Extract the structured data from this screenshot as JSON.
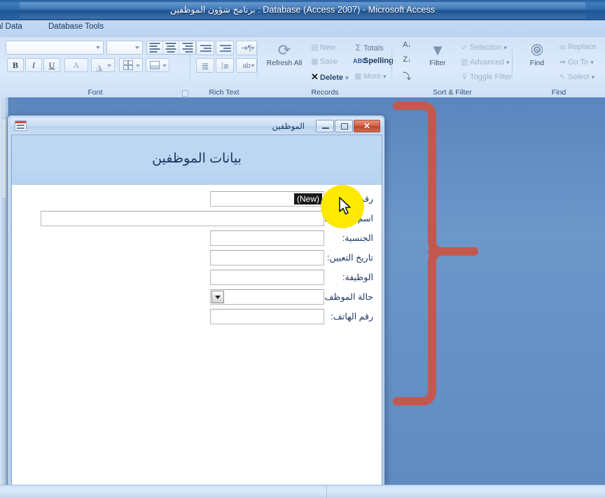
{
  "window": {
    "title": "برنامج شؤون الموظفين : Database (Access 2007) - Microsoft Access"
  },
  "ribbon": {
    "tabs": [
      {
        "label": "nal Data"
      },
      {
        "label": "Database Tools"
      }
    ],
    "groups": [
      {
        "label": "Font"
      },
      {
        "label": "Rich Text"
      },
      {
        "label": "Records"
      },
      {
        "label": "Sort & Filter"
      },
      {
        "label": "Find"
      }
    ],
    "font_group": {
      "bold": "B",
      "italic": "I",
      "underline": "U",
      "font_color": "A",
      "highlight": "fill-icon",
      "gridlines": "grid-icon",
      "alt_fill": "alt-fill-icon",
      "font_name_value": "",
      "font_size_value": "",
      "align_left": "align-left-icon",
      "align_center": "align-center-icon",
      "align_right": "align-right-icon"
    },
    "rich_text": {
      "decrease_indent": "decrease-indent-icon",
      "increase_indent": "increase-indent-icon",
      "ltr_rtl": "text-direction-icon",
      "numbering": "numbering-icon",
      "bullets": "bullets-icon",
      "format_painter": "format-painter-icon"
    },
    "records": {
      "refresh_all": "Refresh\nAll",
      "refresh_all_line1": "Refresh",
      "refresh_all_line2": "All",
      "new": "New",
      "save": "Save",
      "delete": "Delete",
      "totals": "Totals",
      "spelling": "Spelling",
      "more": "More",
      "totals_symbol": "Σ",
      "spelling_symbol": "ABC",
      "delete_symbol": "✕"
    },
    "sort_filter": {
      "sort_asc": "A-Z-sort-ascending-icon",
      "sort_desc": "Z-A-sort-descending-icon",
      "clear_sort": "clear-sort-icon",
      "filter": "Filter",
      "selection": "Selection",
      "advanced": "Advanced",
      "toggle_filter": "Toggle Filter"
    },
    "find": {
      "find": "Find",
      "replace": "Replace",
      "go_to": "Go To",
      "select": "Select"
    }
  },
  "child_window": {
    "title": "الموظفين",
    "minimize": "minimize-icon",
    "maximize": "maximize-icon",
    "close": "✕"
  },
  "form": {
    "header_title": "بيانات الموظفين",
    "fields": [
      {
        "label": "رقم الموظف:",
        "value": "(New)",
        "type": "text-highlighted"
      },
      {
        "label": "اسم الموظف:",
        "value": "",
        "type": "text-wide"
      },
      {
        "label": "الجنسية:",
        "value": "",
        "type": "text"
      },
      {
        "label": "تاريخ التعيين:",
        "value": "",
        "type": "text"
      },
      {
        "label": "الوظيفة:",
        "value": "",
        "type": "text"
      },
      {
        "label": "حالة الموظف:",
        "value": "",
        "type": "combo"
      },
      {
        "label": "رقم الهاتف:",
        "value": "",
        "type": "text"
      }
    ]
  },
  "annotations": {
    "brace_color": "#c3584f",
    "cursor_highlight_color": "#ffe800"
  },
  "colors": {
    "titlebar_blue": "#2f6aae",
    "ribbon_blue": "#d3e3f8",
    "workspace_blue": "#6d97c9",
    "form_header_blue": "#bcd7f2",
    "label_text": "#1f3864",
    "close_red": "#c74b30"
  },
  "statusbar": {
    "text": ""
  }
}
